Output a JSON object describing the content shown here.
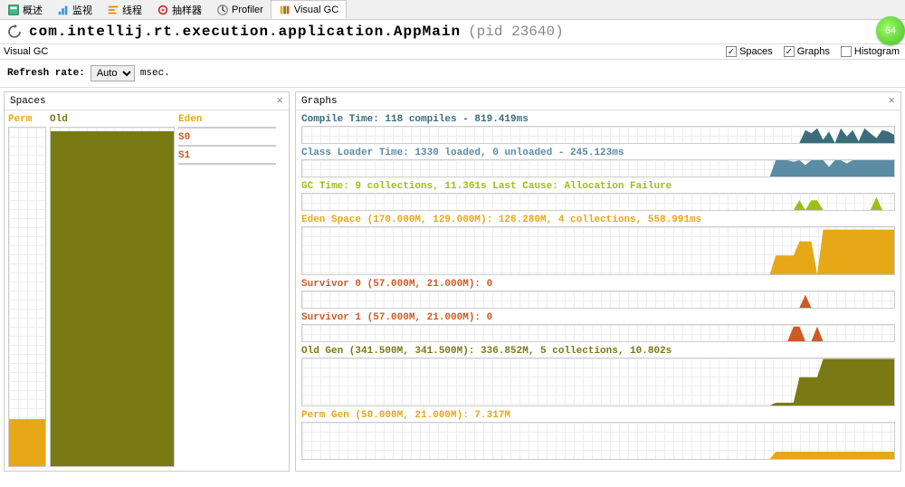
{
  "tabs": [
    {
      "label": "概述"
    },
    {
      "label": "监视"
    },
    {
      "label": "线程"
    },
    {
      "label": "抽样器"
    },
    {
      "label": "Profiler"
    },
    {
      "label": "Visual GC",
      "active": true
    }
  ],
  "title": {
    "main": "com.intellij.rt.execution.application.AppMain",
    "pid": "(pid 23640)"
  },
  "badge": "64",
  "subheader": {
    "label": "Visual GC",
    "checks": [
      {
        "label": "Spaces",
        "checked": true
      },
      {
        "label": "Graphs",
        "checked": true
      },
      {
        "label": "Histogram",
        "checked": false
      }
    ]
  },
  "refresh": {
    "label": "Refresh rate:",
    "value": "Auto",
    "unit": "msec."
  },
  "spaces_panel": {
    "title": "Spaces",
    "perm": {
      "label": "Perm",
      "fill_pct": 14,
      "color": "#e6a817"
    },
    "old": {
      "label": "Old",
      "fill_pct": 99,
      "color": "#7a7a15"
    },
    "eden": {
      "label": "Eden",
      "fill_pct": 99,
      "color": "#e6a817"
    },
    "s0": {
      "label": "S0",
      "fill_pct": 0,
      "color": "#cc5a26"
    },
    "s1": {
      "label": "S1",
      "fill_pct": 0,
      "color": "#cc5a26"
    }
  },
  "graphs_panel": {
    "title": "Graphs",
    "rows": [
      {
        "key": "compile",
        "title": "Compile Time: 118 compiles - 819.419ms",
        "height": 20,
        "color": "#3b6d7a"
      },
      {
        "key": "loader",
        "title": "Class Loader Time: 1330 loaded, 0 unloaded - 245.123ms",
        "height": 20,
        "color": "#5a8ca3"
      },
      {
        "key": "gc",
        "title": "GC Time: 9 collections, 11.361s  Last Cause: Allocation Failure",
        "height": 20,
        "color": "#9bbf16"
      },
      {
        "key": "eden",
        "title": "Eden Space (170.000M, 129.000M): 126.280M, 4 collections, 558.991ms",
        "height": 54,
        "color": "#e6a817"
      },
      {
        "key": "s0",
        "title": "Survivor 0 (57.000M, 21.000M): 0",
        "height": 20,
        "color": "#cc5a26"
      },
      {
        "key": "s1",
        "title": "Survivor 1 (57.000M, 21.000M): 0",
        "height": 20,
        "color": "#cc5a26"
      },
      {
        "key": "old",
        "title": "Old Gen (341.500M, 341.500M): 336.852M, 5 collections, 10.802s",
        "height": 54,
        "color": "#7a7a15"
      },
      {
        "key": "perm",
        "title": "Perm Gen (50.000M, 21.000M): 7.317M",
        "height": 42,
        "color": "#e6a817"
      }
    ]
  },
  "chart_data": {
    "type": "area",
    "note": "Approx. time-series read from Visual GC graphs. x=0..100 left→right; y=0..100 percent of row height.",
    "series": {
      "compile": [
        0,
        0,
        0,
        0,
        0,
        0,
        0,
        0,
        0,
        0,
        0,
        0,
        0,
        0,
        0,
        0,
        0,
        0,
        0,
        0,
        0,
        0,
        0,
        0,
        0,
        0,
        0,
        0,
        0,
        0,
        0,
        0,
        0,
        0,
        0,
        0,
        0,
        0,
        0,
        0,
        0,
        0,
        0,
        0,
        0,
        0,
        0,
        0,
        0,
        0,
        0,
        0,
        0,
        0,
        0,
        0,
        0,
        0,
        0,
        0,
        0,
        0,
        0,
        0,
        0,
        0,
        0,
        0,
        0,
        0,
        0,
        0,
        0,
        0,
        0,
        0,
        0,
        0,
        0,
        0,
        0,
        0,
        0,
        0,
        0,
        80,
        60,
        90,
        20,
        70,
        0,
        90,
        40,
        80,
        10,
        90,
        60,
        30,
        80,
        70,
        50
      ],
      "loader": [
        0,
        0,
        0,
        0,
        0,
        0,
        0,
        0,
        0,
        0,
        0,
        0,
        0,
        0,
        0,
        0,
        0,
        0,
        0,
        0,
        0,
        0,
        0,
        0,
        0,
        0,
        0,
        0,
        0,
        0,
        0,
        0,
        0,
        0,
        0,
        0,
        0,
        0,
        0,
        0,
        0,
        0,
        0,
        0,
        0,
        0,
        0,
        0,
        0,
        0,
        0,
        0,
        0,
        0,
        0,
        0,
        0,
        0,
        0,
        0,
        0,
        0,
        0,
        0,
        0,
        0,
        0,
        0,
        0,
        0,
        0,
        0,
        0,
        0,
        0,
        0,
        0,
        0,
        0,
        0,
        100,
        100,
        100,
        90,
        100,
        70,
        100,
        100,
        100,
        60,
        100,
        100,
        80,
        100,
        100,
        100,
        100,
        100,
        100,
        100,
        100
      ],
      "gc": [
        0,
        0,
        0,
        0,
        0,
        0,
        0,
        0,
        0,
        0,
        0,
        0,
        0,
        0,
        0,
        0,
        0,
        0,
        0,
        0,
        0,
        0,
        0,
        0,
        0,
        0,
        0,
        0,
        0,
        0,
        0,
        0,
        0,
        0,
        0,
        0,
        0,
        0,
        0,
        0,
        0,
        0,
        0,
        0,
        0,
        0,
        0,
        0,
        0,
        0,
        0,
        0,
        0,
        0,
        0,
        0,
        0,
        0,
        0,
        0,
        0,
        0,
        0,
        0,
        0,
        0,
        0,
        0,
        0,
        0,
        0,
        0,
        0,
        0,
        0,
        0,
        0,
        0,
        0,
        0,
        0,
        0,
        0,
        0,
        60,
        0,
        60,
        60,
        0,
        0,
        0,
        0,
        0,
        0,
        0,
        0,
        0,
        80,
        0,
        0,
        0
      ],
      "eden": [
        0,
        0,
        0,
        0,
        0,
        0,
        0,
        0,
        0,
        0,
        0,
        0,
        0,
        0,
        0,
        0,
        0,
        0,
        0,
        0,
        0,
        0,
        0,
        0,
        0,
        0,
        0,
        0,
        0,
        0,
        0,
        0,
        0,
        0,
        0,
        0,
        0,
        0,
        0,
        0,
        0,
        0,
        0,
        0,
        0,
        0,
        0,
        0,
        0,
        0,
        0,
        0,
        0,
        0,
        0,
        0,
        0,
        0,
        0,
        0,
        0,
        0,
        0,
        0,
        0,
        0,
        0,
        0,
        0,
        0,
        0,
        0,
        0,
        0,
        0,
        0,
        0,
        0,
        0,
        0,
        40,
        40,
        40,
        40,
        70,
        70,
        70,
        0,
        95,
        95,
        95,
        95,
        95,
        95,
        95,
        95,
        95,
        95,
        95,
        95,
        95
      ],
      "s0": [
        0,
        0,
        0,
        0,
        0,
        0,
        0,
        0,
        0,
        0,
        0,
        0,
        0,
        0,
        0,
        0,
        0,
        0,
        0,
        0,
        0,
        0,
        0,
        0,
        0,
        0,
        0,
        0,
        0,
        0,
        0,
        0,
        0,
        0,
        0,
        0,
        0,
        0,
        0,
        0,
        0,
        0,
        0,
        0,
        0,
        0,
        0,
        0,
        0,
        0,
        0,
        0,
        0,
        0,
        0,
        0,
        0,
        0,
        0,
        0,
        0,
        0,
        0,
        0,
        0,
        0,
        0,
        0,
        0,
        0,
        0,
        0,
        0,
        0,
        0,
        0,
        0,
        0,
        0,
        0,
        0,
        0,
        0,
        0,
        0,
        80,
        0,
        0,
        0,
        0,
        0,
        0,
        0,
        0,
        0,
        0,
        0,
        0,
        0,
        0,
        0
      ],
      "s1": [
        0,
        0,
        0,
        0,
        0,
        0,
        0,
        0,
        0,
        0,
        0,
        0,
        0,
        0,
        0,
        0,
        0,
        0,
        0,
        0,
        0,
        0,
        0,
        0,
        0,
        0,
        0,
        0,
        0,
        0,
        0,
        0,
        0,
        0,
        0,
        0,
        0,
        0,
        0,
        0,
        0,
        0,
        0,
        0,
        0,
        0,
        0,
        0,
        0,
        0,
        0,
        0,
        0,
        0,
        0,
        0,
        0,
        0,
        0,
        0,
        0,
        0,
        0,
        0,
        0,
        0,
        0,
        0,
        0,
        0,
        0,
        0,
        0,
        0,
        0,
        0,
        0,
        0,
        0,
        0,
        0,
        0,
        0,
        90,
        90,
        0,
        0,
        90,
        0,
        0,
        0,
        0,
        0,
        0,
        0,
        0,
        0,
        0,
        0,
        0,
        0
      ],
      "old": [
        0,
        0,
        0,
        0,
        0,
        0,
        0,
        0,
        0,
        0,
        0,
        0,
        0,
        0,
        0,
        0,
        0,
        0,
        0,
        0,
        0,
        0,
        0,
        0,
        0,
        0,
        0,
        0,
        0,
        0,
        0,
        0,
        0,
        0,
        0,
        0,
        0,
        0,
        0,
        0,
        0,
        0,
        0,
        0,
        0,
        0,
        0,
        0,
        0,
        0,
        0,
        0,
        0,
        0,
        0,
        0,
        0,
        0,
        0,
        0,
        0,
        0,
        0,
        0,
        0,
        0,
        0,
        0,
        0,
        0,
        0,
        0,
        0,
        0,
        0,
        0,
        0,
        0,
        0,
        0,
        6,
        6,
        6,
        6,
        60,
        60,
        60,
        60,
        99,
        99,
        99,
        99,
        99,
        99,
        99,
        99,
        99,
        99,
        99,
        99,
        99
      ],
      "perm": [
        0,
        0,
        0,
        0,
        0,
        0,
        0,
        0,
        0,
        0,
        0,
        0,
        0,
        0,
        0,
        0,
        0,
        0,
        0,
        0,
        0,
        0,
        0,
        0,
        0,
        0,
        0,
        0,
        0,
        0,
        0,
        0,
        0,
        0,
        0,
        0,
        0,
        0,
        0,
        0,
        0,
        0,
        0,
        0,
        0,
        0,
        0,
        0,
        0,
        0,
        0,
        0,
        0,
        0,
        0,
        0,
        0,
        0,
        0,
        0,
        0,
        0,
        0,
        0,
        0,
        0,
        0,
        0,
        0,
        0,
        0,
        0,
        0,
        0,
        0,
        0,
        0,
        0,
        0,
        0,
        20,
        20,
        20,
        20,
        20,
        20,
        20,
        20,
        20,
        20,
        20,
        20,
        20,
        20,
        20,
        20,
        20,
        20,
        20,
        20,
        20
      ]
    }
  }
}
